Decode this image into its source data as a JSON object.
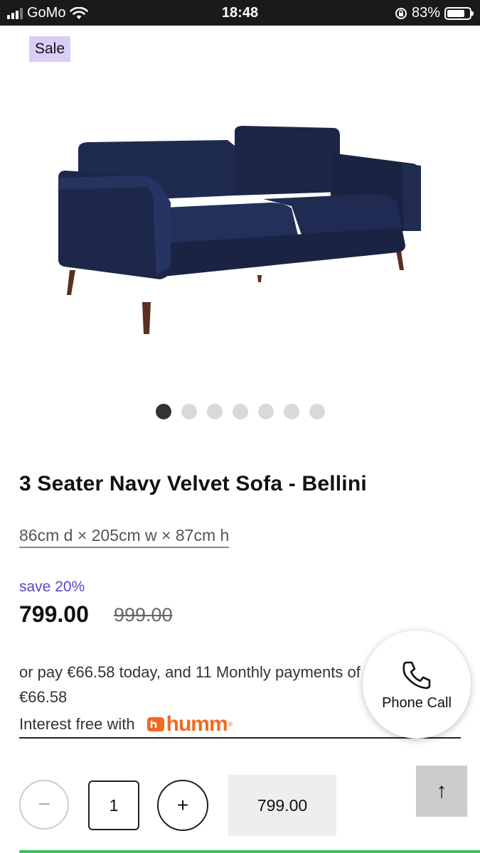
{
  "status_bar": {
    "carrier": "GoMo",
    "time": "18:48",
    "battery_percent": "83%",
    "battery_level": 0.83,
    "signal_icon": "signal-bars-icon",
    "wifi_icon": "wifi-icon",
    "orientation_lock_icon": "orientation-lock-icon"
  },
  "badge": {
    "label": "Sale"
  },
  "gallery": {
    "image": "navy-velvet-sofa",
    "dot_count": 7,
    "active_index": 0
  },
  "product": {
    "title": "3 Seater Navy Velvet Sofa - Bellini",
    "dimensions": "86cm d × 205cm w × 87cm h",
    "save_text": "save 20%",
    "price": "799.00",
    "old_price": "999.00"
  },
  "finance": {
    "line1": "or pay €66.58 today, and 11 Monthly payments of",
    "line2": "€66.58",
    "interest_text": "Interest free with",
    "brand": "humm",
    "brand_reg": "®",
    "brand_color": "#f06a22"
  },
  "phone_call": {
    "label": "Phone Call",
    "icon": "phone-icon"
  },
  "cart": {
    "minus_label": "−",
    "quantity": "1",
    "plus_label": "+",
    "add_price": "799.00"
  },
  "scroll_top": {
    "label": "↑",
    "icon": "arrow-up-icon"
  },
  "colors": {
    "accent_purple": "#5b45c9",
    "sale_bg": "#d9cef6",
    "status_bar_bg": "#1a1a1a",
    "success_green": "#35c759"
  }
}
